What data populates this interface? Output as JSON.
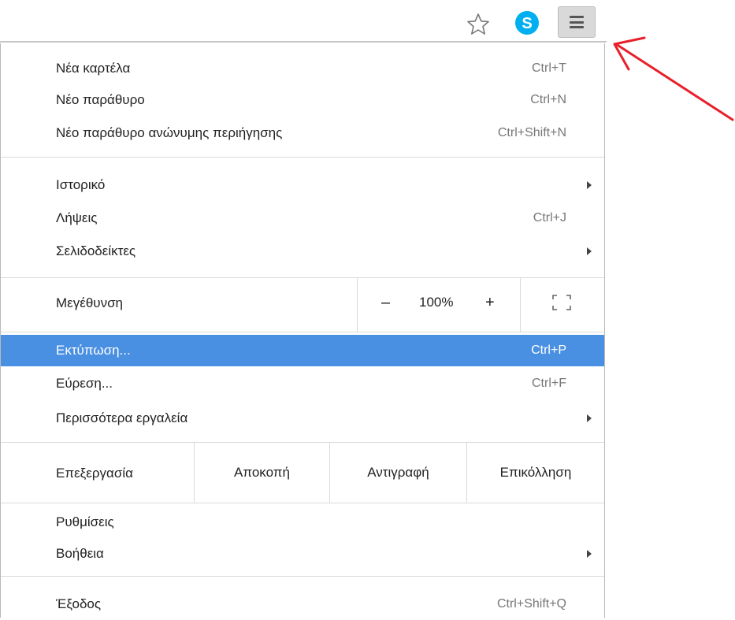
{
  "toolbar": {
    "icons": [
      "star-icon",
      "skype-icon",
      "hamburger-icon"
    ],
    "skype_color": "#00aff0"
  },
  "menu": {
    "new_tab": {
      "label": "Νέα καρτέλα",
      "shortcut": "Ctrl+T"
    },
    "new_window": {
      "label": "Νέο παράθυρο",
      "shortcut": "Ctrl+N"
    },
    "incognito": {
      "label": "Νέο παράθυρο ανώνυμης περιήγησης",
      "shortcut": "Ctrl+Shift+N"
    },
    "history": {
      "label": "Ιστορικό"
    },
    "downloads": {
      "label": "Λήψεις",
      "shortcut": "Ctrl+J"
    },
    "bookmarks": {
      "label": "Σελιδοδείκτες"
    },
    "zoom": {
      "label": "Μεγέθυνση",
      "minus": "–",
      "value": "100%",
      "plus": "+"
    },
    "print": {
      "label": "Εκτύπωση...",
      "shortcut": "Ctrl+P"
    },
    "find": {
      "label": "Εύρεση...",
      "shortcut": "Ctrl+F"
    },
    "more_tools": {
      "label": "Περισσότερα εργαλεία"
    },
    "edit": {
      "label": "Επεξεργασία",
      "cut": "Αποκοπή",
      "copy": "Αντιγραφή",
      "paste": "Επικόλληση"
    },
    "settings": {
      "label": "Ρυθμίσεις"
    },
    "help": {
      "label": "Βοήθεια"
    },
    "exit": {
      "label": "Έξοδος",
      "shortcut": "Ctrl+Shift+Q"
    }
  },
  "colors": {
    "highlight": "#4a90e2",
    "annotation_arrow": "#e8202a"
  }
}
